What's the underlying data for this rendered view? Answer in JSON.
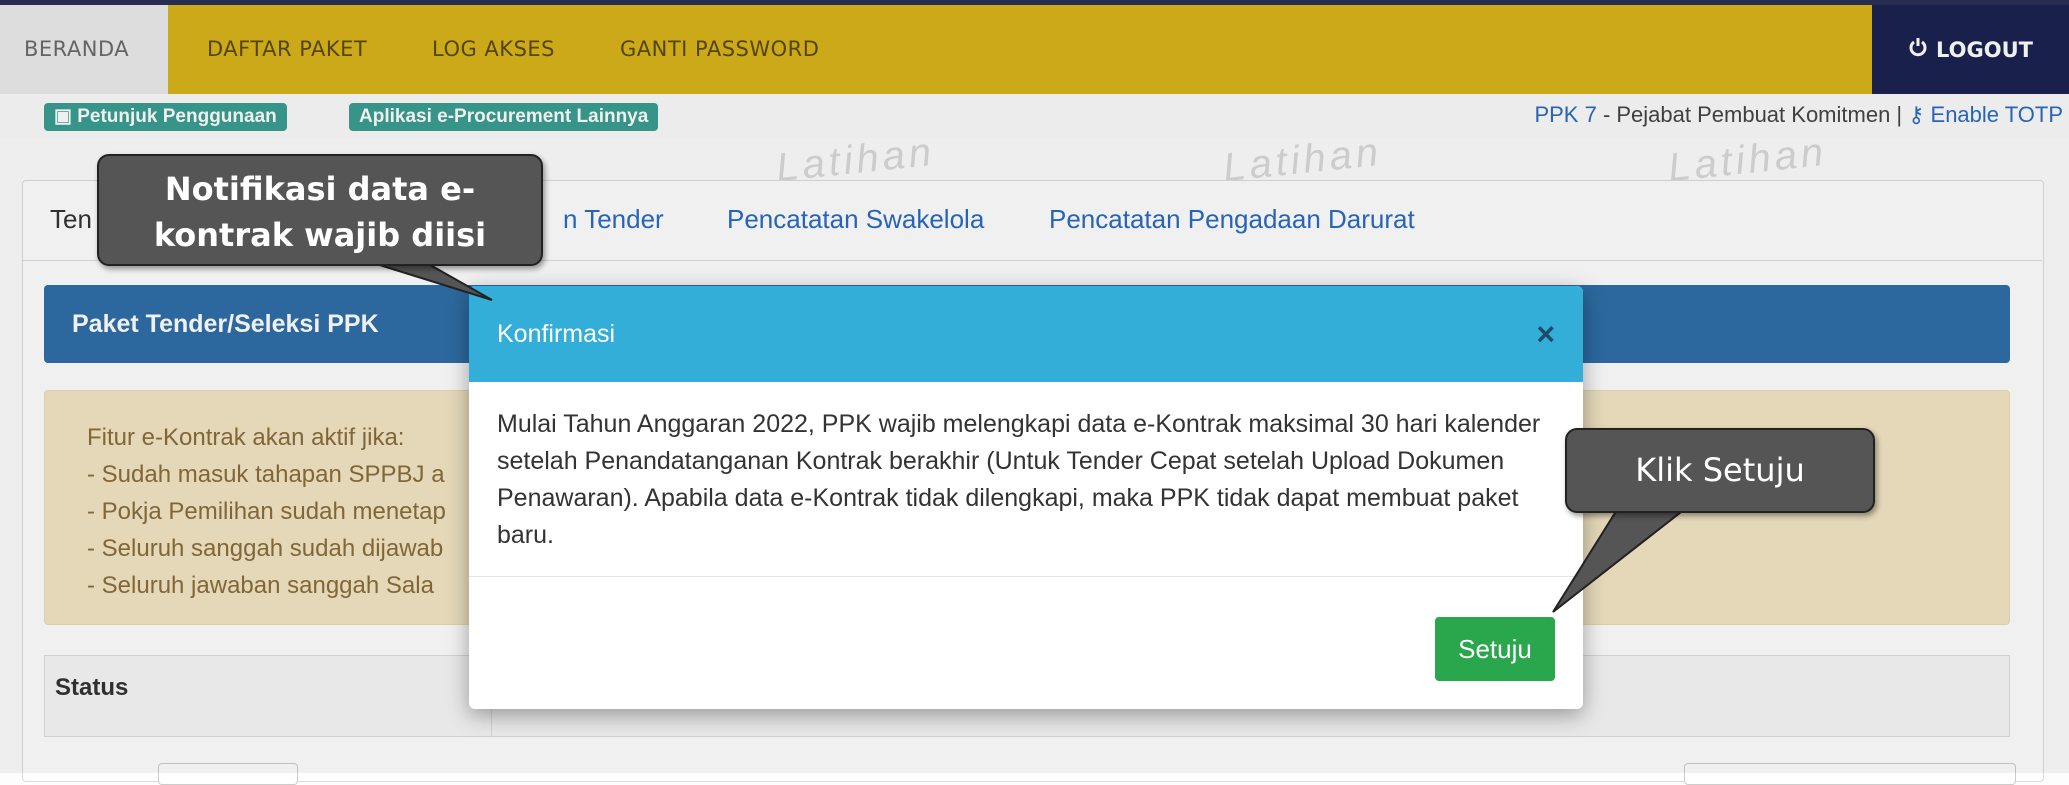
{
  "nav": {
    "items": [
      "BERANDA",
      "DAFTAR PAKET",
      "LOG AKSES",
      "GANTI PASSWORD"
    ],
    "logout_label": "LOGOUT"
  },
  "subbar": {
    "guide_label": "Petunjuk Penggunaan",
    "apps_label": "Aplikasi e-Procurement Lainnya",
    "user_role": "PPK 7",
    "user_title": "- Pejabat Pembuat Komitmen |",
    "totp_label": "Enable TOTP"
  },
  "watermark_text": "Latihan",
  "tabs": {
    "partial_first": "Ten",
    "partial_second": "n Tender",
    "swakelola": "Pencatatan Swakelola",
    "darurat": "Pencatatan Pengadaan Darurat"
  },
  "package_header": "Paket Tender/Seleksi PPK",
  "info_lines": [
    "Fitur e-Kontrak akan aktif jika:",
    "- Sudah masuk tahapan SPPBJ a",
    "- Pokja Pemilihan sudah menetap",
    "- Seluruh sanggah sudah dijawab",
    "- Seluruh jawaban sanggah Sala"
  ],
  "status_label": "Status",
  "modal": {
    "title": "Konfirmasi",
    "close_symbol": "×",
    "body": "Mulai Tahun Anggaran 2022, PPK wajib melengkapi data e-Kontrak maksimal 30 hari kalender setelah Penandatanganan Kontrak berakhir (Untuk Tender Cepat setelah Upload Dokumen Penawaran). Apabila data e-Kontrak tidak dilengkapi, maka PPK tidak dapat membuat paket baru.",
    "agree_label": "Setuju"
  },
  "callouts": {
    "notification": "Notifikasi data e-kontrak wajib diisi",
    "click_hint": "Klik Setuju"
  },
  "colors": {
    "topbar": "#d8b41a",
    "logout_bg": "#1c2251",
    "modal_header": "#33aed8",
    "agree_button": "#2aa64c",
    "package_header": "#2f6fa8"
  }
}
